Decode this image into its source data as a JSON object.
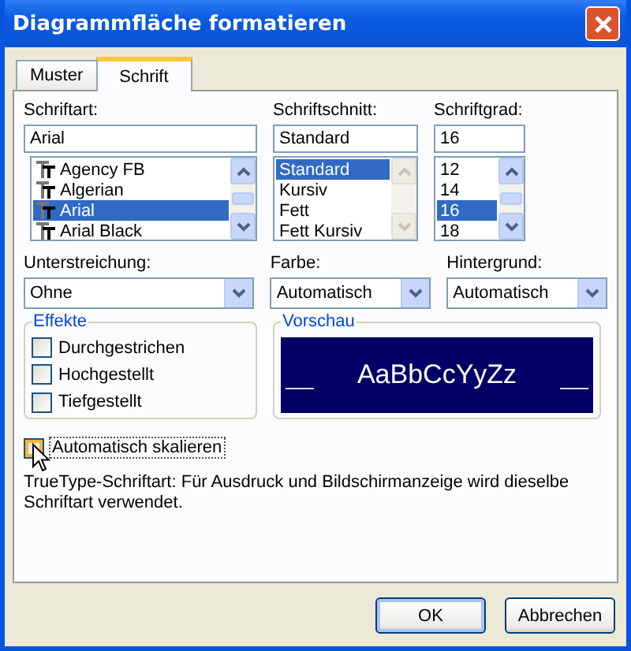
{
  "window": {
    "title": "Diagrammfläche formatieren"
  },
  "tabs": [
    {
      "label": "Muster",
      "selected": false
    },
    {
      "label": "Schrift",
      "selected": true
    }
  ],
  "lists": [
    {
      "label": "Schriftart:",
      "value": "Arial",
      "scrollbar_disabled": false,
      "font_icons": true,
      "items": [
        {
          "label": "Agency FB",
          "selected": false
        },
        {
          "label": "Algerian",
          "selected": false
        },
        {
          "label": "Arial",
          "selected": true
        },
        {
          "label": "Arial Black",
          "selected": false
        }
      ]
    },
    {
      "label": "Schriftschnitt:",
      "value": "Standard",
      "scrollbar_disabled": true,
      "font_icons": false,
      "items": [
        {
          "label": "Standard",
          "selected": true
        },
        {
          "label": "Kursiv",
          "selected": false
        },
        {
          "label": "Fett",
          "selected": false
        },
        {
          "label": "Fett Kursiv",
          "selected": false
        }
      ]
    },
    {
      "label": "Schriftgrad:",
      "value": "16",
      "scrollbar_disabled": false,
      "font_icons": false,
      "items": [
        {
          "label": "12",
          "selected": false
        },
        {
          "label": "14",
          "selected": false
        },
        {
          "label": "16",
          "selected": true
        },
        {
          "label": "18",
          "selected": false
        }
      ]
    }
  ],
  "dropdowns": [
    {
      "label": "Unterstreichung:",
      "value": "Ohne"
    },
    {
      "label": "Farbe:",
      "value": "Automatisch"
    },
    {
      "label": "Hintergrund:",
      "value": "Automatisch"
    }
  ],
  "effects": {
    "title": "Effekte",
    "options": [
      {
        "label": "Durchgestrichen",
        "checked": false
      },
      {
        "label": "Hochgestellt",
        "checked": false
      },
      {
        "label": "Tiefgestellt",
        "checked": false
      }
    ]
  },
  "preview": {
    "title": "Vorschau",
    "sample": "AaBbCcYyZz"
  },
  "auto_scale": {
    "label": "Automatisch skalieren",
    "checked": false
  },
  "note": "TrueType-Schriftart: Für Ausdruck und Bildschirmanzeige wird dieselbe Schriftart verwendet.",
  "buttons": [
    {
      "label": "OK",
      "default": true
    },
    {
      "label": "Abbrechen",
      "default": false
    }
  ]
}
